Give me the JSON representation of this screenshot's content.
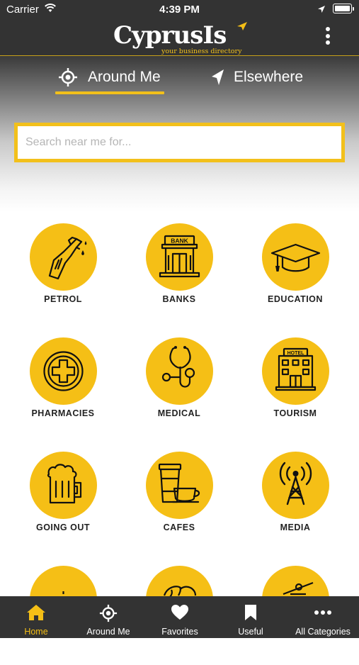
{
  "status_bar": {
    "carrier": "Carrier",
    "time": "4:39 PM"
  },
  "header": {
    "logo_text": "CyprusIs",
    "tagline": "your business directory"
  },
  "tabs": [
    {
      "label": "Around Me",
      "icon": "crosshair-icon",
      "active": true
    },
    {
      "label": "Elsewhere",
      "icon": "location-arrow-icon",
      "active": false
    }
  ],
  "search": {
    "placeholder": "Search near me for...",
    "value": ""
  },
  "categories": [
    {
      "label": "PETROL",
      "icon": "fuel-nozzle-icon"
    },
    {
      "label": "BANKS",
      "icon": "bank-building-icon",
      "icon_text": "BANK"
    },
    {
      "label": "EDUCATION",
      "icon": "graduation-cap-icon"
    },
    {
      "label": "PHARMACIES",
      "icon": "medical-cross-icon"
    },
    {
      "label": "MEDICAL",
      "icon": "stethoscope-icon"
    },
    {
      "label": "TOURISM",
      "icon": "hotel-building-icon",
      "icon_text": "HOTEL"
    },
    {
      "label": "GOING OUT",
      "icon": "beer-mug-icon"
    },
    {
      "label": "CAFES",
      "icon": "coffee-cup-icon"
    },
    {
      "label": "MEDIA",
      "icon": "antenna-tower-icon"
    }
  ],
  "bottom_nav": [
    {
      "label": "Home",
      "icon": "home-icon",
      "active": true
    },
    {
      "label": "Around Me",
      "icon": "crosshair-icon",
      "active": false
    },
    {
      "label": "Favorites",
      "icon": "heart-icon",
      "active": false
    },
    {
      "label": "Useful",
      "icon": "bookmark-icon",
      "active": false
    },
    {
      "label": "All Categories",
      "icon": "more-dots-icon",
      "active": false
    }
  ],
  "colors": {
    "accent": "#f5bf16",
    "bar_background": "#333333"
  }
}
